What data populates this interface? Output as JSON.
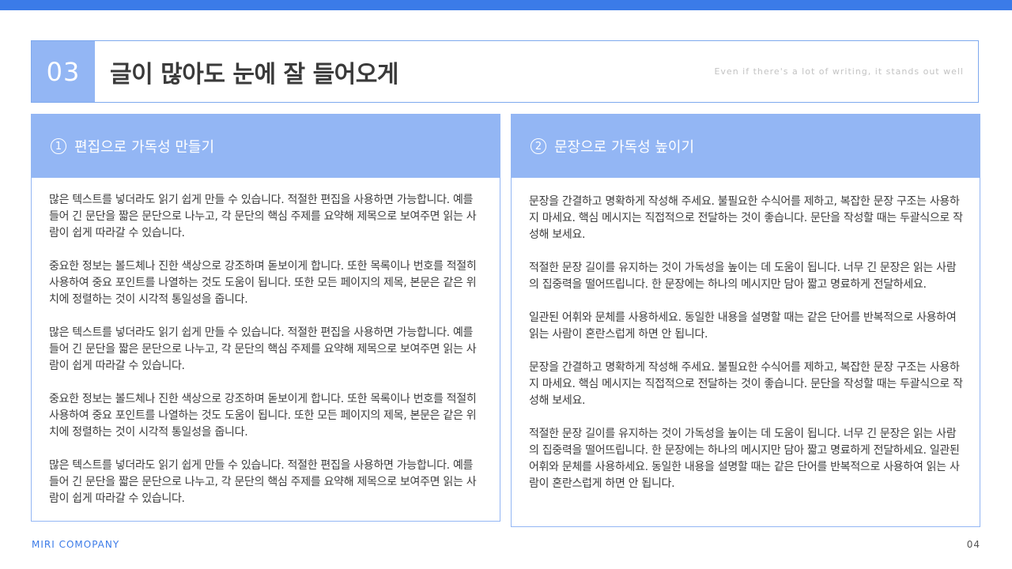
{
  "header": {
    "number": "03",
    "title": "글이 많아도 눈에 잘 들어오게",
    "subtitle": "Even if there's a lot of writing, it stands out well"
  },
  "left_card": {
    "badge": "1",
    "title": "편집으로 가독성 만들기",
    "paragraphs": [
      "많은 텍스트를 넣더라도 읽기 쉽게 만들 수 있습니다. 적절한 편집을 사용하면 가능합니다. 예를 들어 긴 문단을 짧은 문단으로 나누고, 각 문단의 핵심 주제를 요약해 제목으로 보여주면 읽는 사람이 쉽게 따라갈 수 있습니다.",
      "중요한 정보는 볼드체나 진한 색상으로 강조하며 돋보이게 합니다. 또한 목록이나 번호를 적절히 사용하여 중요 포인트를 나열하는 것도 도움이 됩니다. 또한 모든 페이지의 제목, 본문은 같은 위치에 정렬하는 것이 시각적 통일성을 줍니다.",
      "많은 텍스트를 넣더라도 읽기 쉽게 만들 수 있습니다. 적절한 편집을 사용하면 가능합니다. 예를 들어 긴 문단을 짧은 문단으로 나누고, 각 문단의 핵심 주제를 요약해 제목으로 보여주면 읽는 사람이 쉽게 따라갈 수 있습니다.",
      "중요한 정보는 볼드체나 진한 색상으로 강조하며 돋보이게 합니다. 또한 목록이나 번호를 적절히 사용하여 중요 포인트를 나열하는 것도 도움이 됩니다. 또한 모든 페이지의 제목, 본문은 같은 위치에 정렬하는 것이 시각적 통일성을 줍니다.",
      "많은 텍스트를 넣더라도 읽기 쉽게 만들 수 있습니다. 적절한 편집을 사용하면 가능합니다. 예를 들어 긴 문단을 짧은 문단으로 나누고, 각 문단의 핵심 주제를 요약해 제목으로 보여주면 읽는 사람이 쉽게 따라갈 수 있습니다."
    ]
  },
  "right_card": {
    "badge": "2",
    "title": "문장으로 가독성 높이기",
    "paragraphs": [
      "문장을 간결하고 명확하게 작성해 주세요. 불필요한 수식어를 제하고, 복잡한 문장 구조는 사용하지 마세요. 핵심 메시지는 직접적으로 전달하는 것이 좋습니다. 문단을 작성할 때는 두괄식으로 작성해 보세요.",
      "적절한 문장 길이를 유지하는 것이 가독성을 높이는 데 도움이 됩니다. 너무 긴 문장은 읽는 사람의 집중력을 떨어뜨립니다. 한 문장에는 하나의 메시지만 담아 짧고 명료하게 전달하세요.",
      "일관된 어휘와 문체를 사용하세요. 동일한 내용을 설명할 때는 같은 단어를 반복적으로 사용하여 읽는 사람이 혼란스럽게 하면 안 됩니다.",
      "문장을 간결하고 명확하게 작성해 주세요. 불필요한 수식어를 제하고, 복잡한 문장 구조는 사용하지 마세요. 핵심 메시지는 직접적으로 전달하는 것이 좋습니다. 문단을 작성할 때는 두괄식으로 작성해 보세요.",
      "적절한 문장 길이를 유지하는 것이 가독성을 높이는 데 도움이 됩니다. 너무 긴 문장은 읽는 사람의 집중력을 떨어뜨립니다. 한 문장에는 하나의 메시지만 담아 짧고 명료하게 전달하세요. 일관된 어휘와 문체를 사용하세요. 동일한 내용을 설명할 때는 같은 단어를 반복적으로 사용하여 읽는 사람이 혼란스럽게 하면 안 됩니다."
    ]
  },
  "footer": {
    "brand": "MIRI COMOPANY",
    "page": "04"
  },
  "colors": {
    "accent": "#3b7be8",
    "light_accent": "#93b6f4"
  }
}
